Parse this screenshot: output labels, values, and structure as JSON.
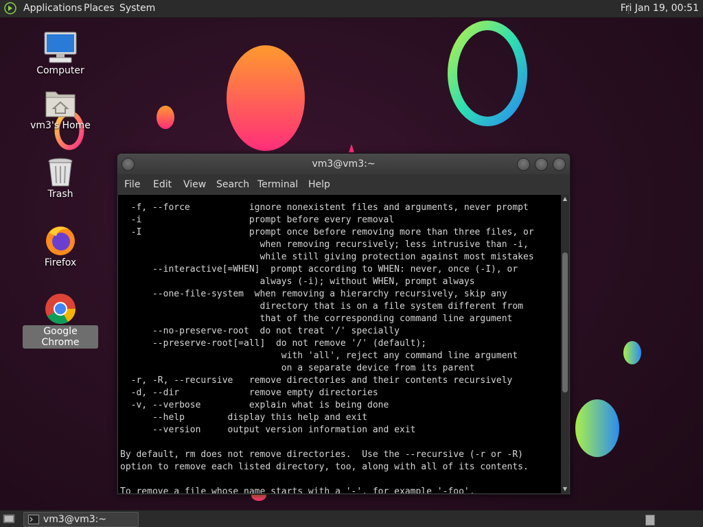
{
  "top_panel": {
    "menus": [
      "Applications",
      "Places",
      "System"
    ],
    "clock": "Fri Jan 19, 00:51"
  },
  "desktop_icons": [
    {
      "label": "Computer",
      "icon": "computer-icon"
    },
    {
      "label": "vm3's Home",
      "icon": "home-folder-icon"
    },
    {
      "label": "Trash",
      "icon": "trash-icon"
    },
    {
      "label": "Firefox",
      "icon": "firefox-icon"
    },
    {
      "label": "Google Chrome",
      "icon": "chrome-icon"
    }
  ],
  "terminal": {
    "title": "vm3@vm3:~",
    "menu": [
      "File",
      "Edit",
      "View",
      "Search",
      "Terminal",
      "Help"
    ],
    "content": "  -f, --force           ignore nonexistent files and arguments, never prompt\n  -i                    prompt before every removal\n  -I                    prompt once before removing more than three files, or\n                          when removing recursively; less intrusive than -i,\n                          while still giving protection against most mistakes\n      --interactive[=WHEN]  prompt according to WHEN: never, once (-I), or\n                          always (-i); without WHEN, prompt always\n      --one-file-system  when removing a hierarchy recursively, skip any\n                          directory that is on a file system different from\n                          that of the corresponding command line argument\n      --no-preserve-root  do not treat '/' specially\n      --preserve-root[=all]  do not remove '/' (default);\n                              with 'all', reject any command line argument\n                              on a separate device from its parent\n  -r, -R, --recursive   remove directories and their contents recursively\n  -d, --dir             remove empty directories\n  -v, --verbose         explain what is being done\n      --help        display this help and exit\n      --version     output version information and exit\n\nBy default, rm does not remove directories.  Use the --recursive (-r or -R)\noption to remove each listed directory, too, along with all of its contents.\n\nTo remove a file whose name starts with a '-', for example '-foo',"
  },
  "bottom_panel": {
    "task_label": "vm3@vm3:~"
  }
}
